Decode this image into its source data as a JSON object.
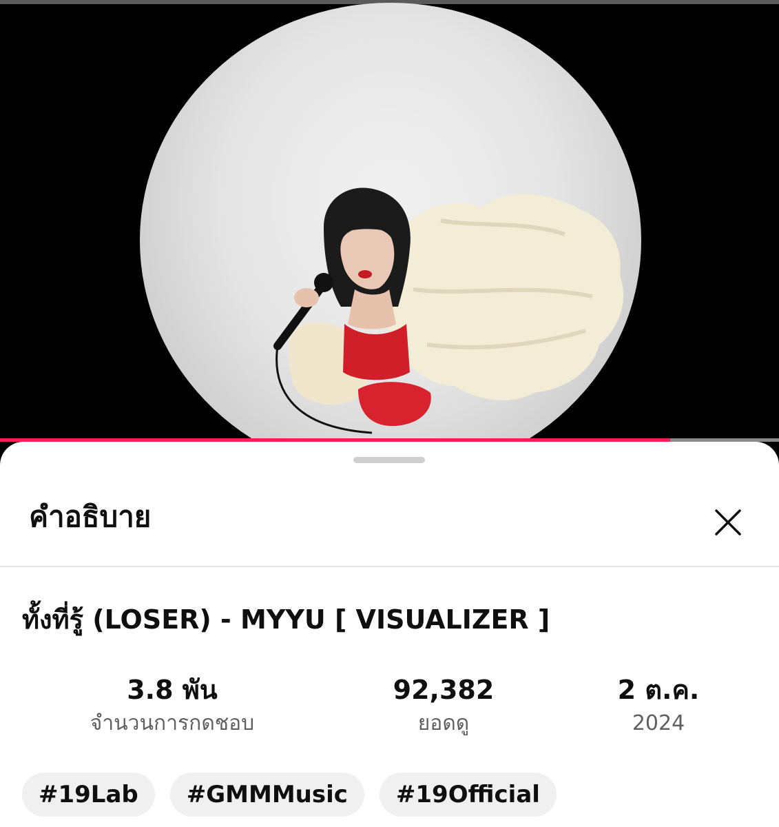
{
  "player": {
    "progress_fraction": 0.86,
    "accent_color": "#f22056"
  },
  "sheet": {
    "title": "คำอธิบาย",
    "close_icon": "close-icon"
  },
  "video": {
    "title": "ทั้งที่รู้ (LOSER) - MYYU [ VISUALIZER ]",
    "stats": [
      {
        "value": "3.8 พัน",
        "label": "จำนวนการกดชอบ"
      },
      {
        "value": "92,382",
        "label": "ยอดดู"
      },
      {
        "value": "2 ต.ค.",
        "label": "2024"
      }
    ],
    "tags": [
      "#19Lab",
      "#GMMMusic",
      "#19Official"
    ]
  }
}
